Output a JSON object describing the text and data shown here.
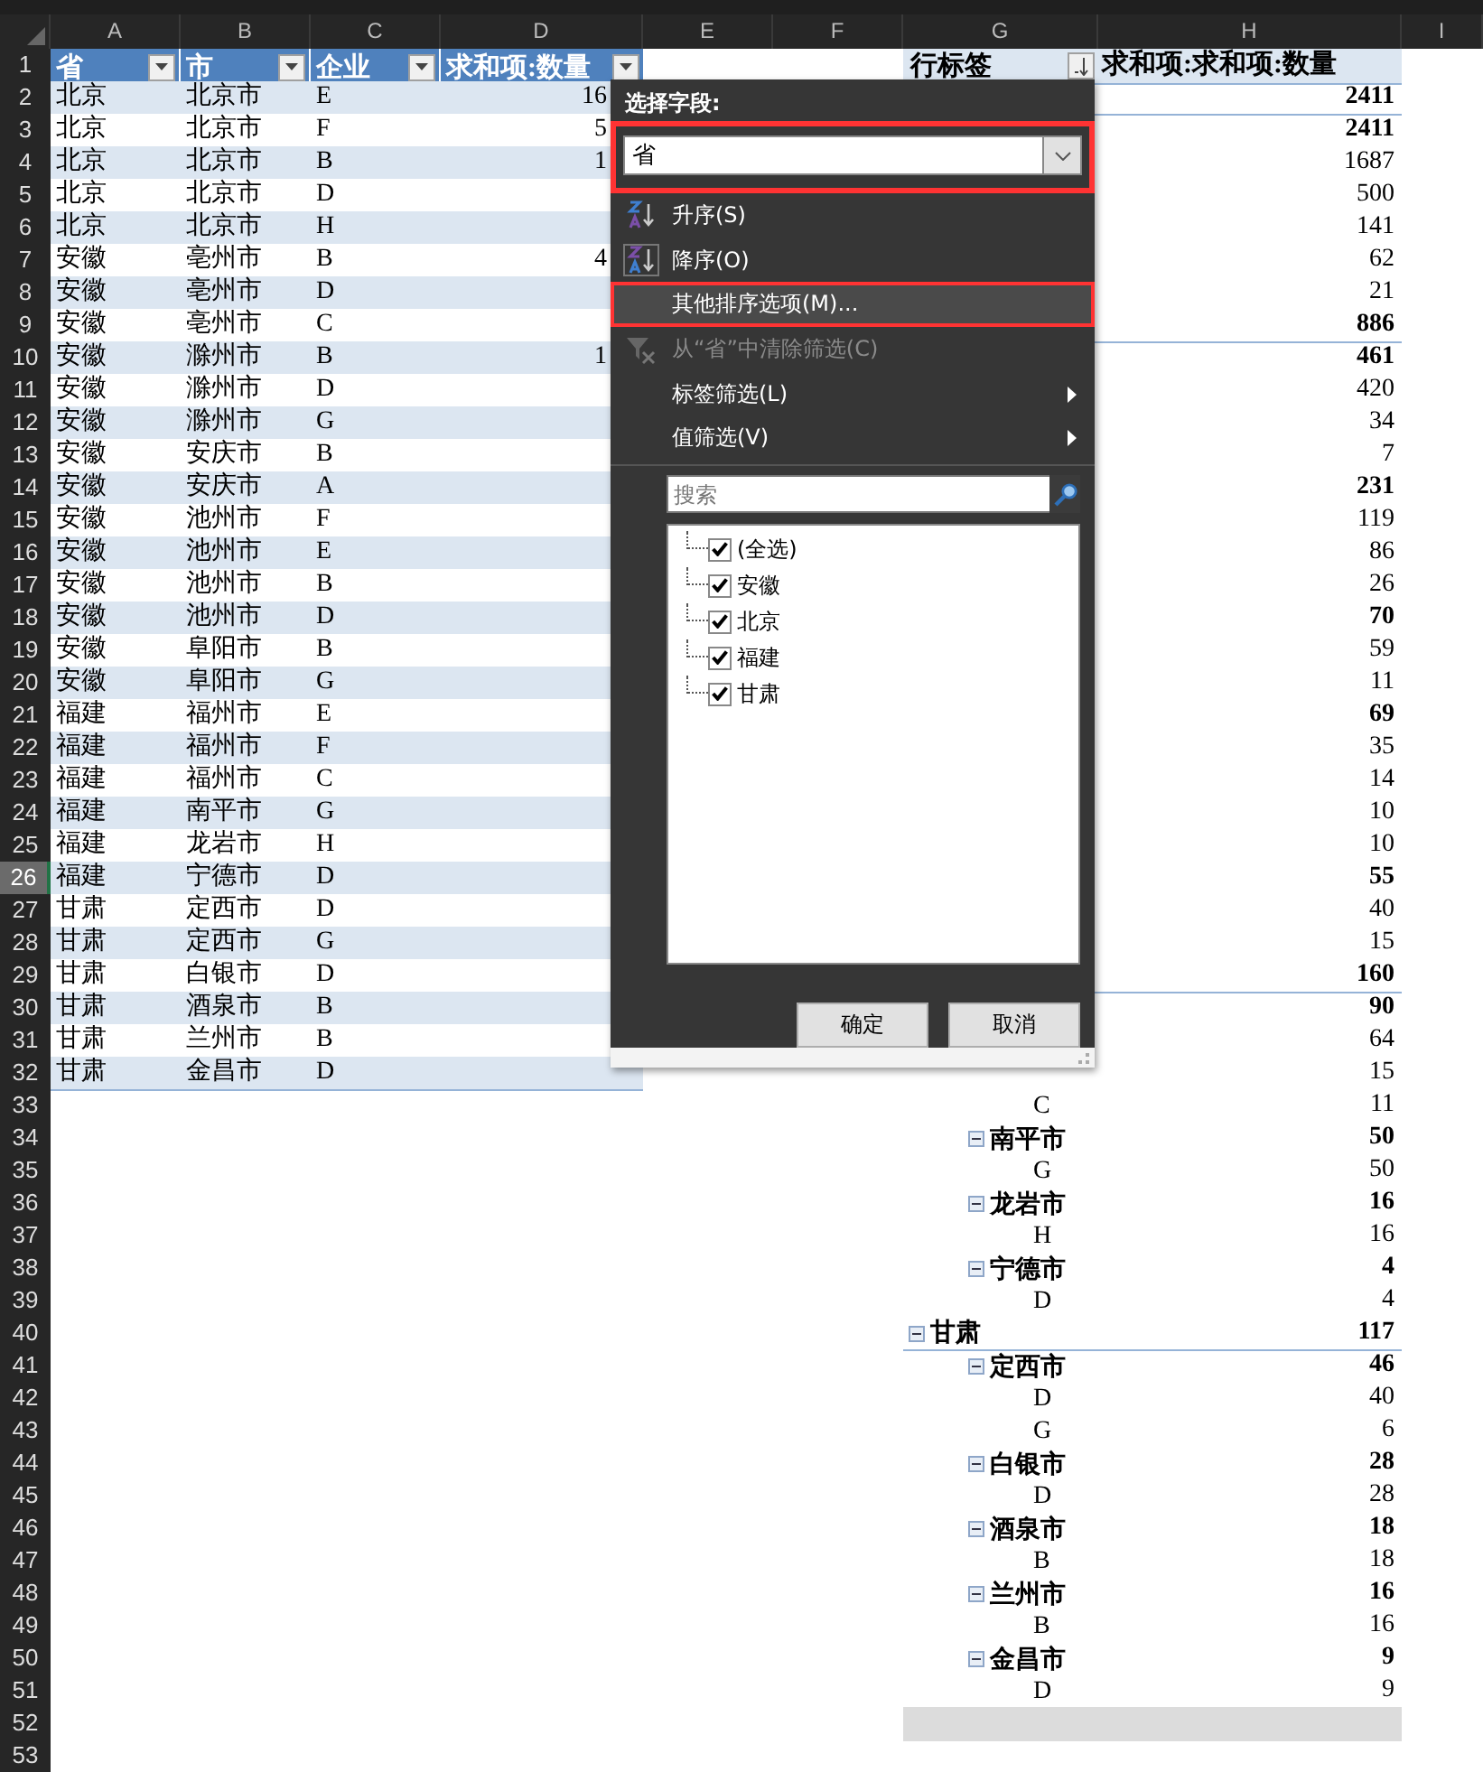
{
  "columns": [
    "A",
    "B",
    "C",
    "D",
    "E",
    "F",
    "G",
    "H",
    "I"
  ],
  "row_numbers": [
    {
      "label": "1",
      "selected": false
    },
    {
      "label": "2",
      "selected": false
    },
    {
      "label": "3",
      "selected": false
    },
    {
      "label": "4",
      "selected": false
    },
    {
      "label": "5",
      "selected": false
    },
    {
      "label": "6",
      "selected": false
    },
    {
      "label": "7",
      "selected": false
    },
    {
      "label": "8",
      "selected": false
    },
    {
      "label": "9",
      "selected": false
    },
    {
      "label": "10",
      "selected": false
    },
    {
      "label": "11",
      "selected": false
    },
    {
      "label": "12",
      "selected": false
    },
    {
      "label": "13",
      "selected": false
    },
    {
      "label": "14",
      "selected": false
    },
    {
      "label": "15",
      "selected": false
    },
    {
      "label": "16",
      "selected": false
    },
    {
      "label": "17",
      "selected": false
    },
    {
      "label": "18",
      "selected": false
    },
    {
      "label": "19",
      "selected": false
    },
    {
      "label": "20",
      "selected": false
    },
    {
      "label": "21",
      "selected": false
    },
    {
      "label": "22",
      "selected": false
    },
    {
      "label": "23",
      "selected": false
    },
    {
      "label": "24",
      "selected": false
    },
    {
      "label": "25",
      "selected": false
    },
    {
      "label": "26",
      "selected": true
    },
    {
      "label": "27",
      "selected": false
    },
    {
      "label": "28",
      "selected": false
    },
    {
      "label": "29",
      "selected": false
    },
    {
      "label": "30",
      "selected": false
    },
    {
      "label": "31",
      "selected": false
    },
    {
      "label": "32",
      "selected": false
    },
    {
      "label": "33",
      "selected": false
    },
    {
      "label": "34",
      "selected": false
    },
    {
      "label": "35",
      "selected": false
    },
    {
      "label": "36",
      "selected": false
    },
    {
      "label": "37",
      "selected": false
    },
    {
      "label": "38",
      "selected": false
    },
    {
      "label": "39",
      "selected": false
    },
    {
      "label": "40",
      "selected": false
    },
    {
      "label": "41",
      "selected": false
    },
    {
      "label": "42",
      "selected": false
    },
    {
      "label": "43",
      "selected": false
    },
    {
      "label": "44",
      "selected": false
    },
    {
      "label": "45",
      "selected": false
    },
    {
      "label": "46",
      "selected": false
    },
    {
      "label": "47",
      "selected": false
    },
    {
      "label": "48",
      "selected": false
    },
    {
      "label": "49",
      "selected": false
    },
    {
      "label": "50",
      "selected": false
    },
    {
      "label": "51",
      "selected": false
    },
    {
      "label": "52",
      "selected": false
    },
    {
      "label": "53",
      "selected": false
    }
  ],
  "table": {
    "headers": [
      "省",
      "市",
      "企业",
      "求和项:数量"
    ],
    "rows": [
      [
        "北京",
        "北京市",
        "E",
        "16"
      ],
      [
        "北京",
        "北京市",
        "F",
        "5"
      ],
      [
        "北京",
        "北京市",
        "B",
        "1"
      ],
      [
        "北京",
        "北京市",
        "D"
      ],
      [
        "北京",
        "北京市",
        "H"
      ],
      [
        "安徽",
        "亳州市",
        "B",
        "4"
      ],
      [
        "安徽",
        "亳州市",
        "D"
      ],
      [
        "安徽",
        "亳州市",
        "C"
      ],
      [
        "安徽",
        "滁州市",
        "B",
        "1"
      ],
      [
        "安徽",
        "滁州市",
        "D"
      ],
      [
        "安徽",
        "滁州市",
        "G"
      ],
      [
        "安徽",
        "安庆市",
        "B"
      ],
      [
        "安徽",
        "安庆市",
        "A"
      ],
      [
        "安徽",
        "池州市",
        "F"
      ],
      [
        "安徽",
        "池州市",
        "E"
      ],
      [
        "安徽",
        "池州市",
        "B"
      ],
      [
        "安徽",
        "池州市",
        "D"
      ],
      [
        "安徽",
        "阜阳市",
        "B"
      ],
      [
        "安徽",
        "阜阳市",
        "G"
      ],
      [
        "福建",
        "福州市",
        "E"
      ],
      [
        "福建",
        "福州市",
        "F"
      ],
      [
        "福建",
        "福州市",
        "C"
      ],
      [
        "福建",
        "南平市",
        "G"
      ],
      [
        "福建",
        "龙岩市",
        "H"
      ],
      [
        "福建",
        "宁德市",
        "D"
      ],
      [
        "甘肃",
        "定西市",
        "D"
      ],
      [
        "甘肃",
        "定西市",
        "G"
      ],
      [
        "甘肃",
        "白银市",
        "D"
      ],
      [
        "甘肃",
        "酒泉市",
        "B"
      ],
      [
        "甘肃",
        "兰州市",
        "B"
      ],
      [
        "甘肃",
        "金昌市",
        "D"
      ]
    ]
  },
  "pivot": {
    "headers": [
      "行标签",
      "求和项:求和项:数量"
    ],
    "groups": [
      {
        "value": "2411",
        "children": [
          {
            "value": "2411",
            "children": [
              {
                "value": "1687"
              },
              {
                "value": "500"
              },
              {
                "value": "141"
              },
              {
                "value": "62"
              },
              {
                "value": "21"
              }
            ]
          }
        ]
      },
      {
        "value": "886",
        "children": [
          {
            "value": "461",
            "children": [
              {
                "value": "420"
              },
              {
                "value": "34"
              },
              {
                "value": "7"
              }
            ]
          },
          {
            "value": "231",
            "children": [
              {
                "value": "119"
              },
              {
                "value": "86"
              },
              {
                "value": "26"
              }
            ]
          },
          {
            "value": "70",
            "children": [
              {
                "value": "59"
              },
              {
                "value": "11"
              }
            ]
          },
          {
            "value": "69",
            "children": [
              {
                "value": "35"
              },
              {
                "value": "14"
              },
              {
                "value": "10"
              },
              {
                "value": "10"
              }
            ]
          },
          {
            "value": "55",
            "children": [
              {
                "value": "40"
              },
              {
                "value": "15"
              }
            ]
          }
        ]
      },
      {
        "value": "160",
        "children": [
          {
            "value": "90",
            "children": [
              {
                "value": "64"
              },
              {
                "value": "15"
              },
              {
                "label": "C",
                "value": "11"
              }
            ]
          },
          {
            "label": "南平市",
            "expanded": true,
            "value": "50",
            "children": [
              {
                "label": "G",
                "value": "50"
              }
            ]
          },
          {
            "label": "龙岩市",
            "expanded": true,
            "value": "16",
            "children": [
              {
                "label": "H",
                "value": "16"
              }
            ]
          },
          {
            "label": "宁德市",
            "expanded": true,
            "value": "4",
            "children": [
              {
                "label": "D",
                "value": "4"
              }
            ]
          }
        ]
      },
      {
        "label": "甘肃",
        "expanded": true,
        "value": "117",
        "children": [
          {
            "label": "定西市",
            "expanded": true,
            "value": "46",
            "children": [
              {
                "label": "D",
                "value": "40"
              },
              {
                "label": "G",
                "value": "6"
              }
            ]
          },
          {
            "label": "白银市",
            "expanded": true,
            "value": "28",
            "children": [
              {
                "label": "D",
                "value": "28"
              }
            ]
          },
          {
            "label": "酒泉市",
            "expanded": true,
            "value": "18",
            "children": [
              {
                "label": "B",
                "value": "18"
              }
            ]
          },
          {
            "label": "兰州市",
            "expanded": true,
            "value": "16",
            "children": [
              {
                "label": "B",
                "value": "16"
              }
            ]
          },
          {
            "label": "金昌市",
            "expanded": true,
            "value": "9",
            "children": [
              {
                "label": "D",
                "value": "9"
              }
            ]
          }
        ]
      }
    ]
  },
  "filter_popup": {
    "field_label": "选择字段:",
    "field": {
      "value": "省",
      "highlighted": true
    },
    "menu_items": [
      {
        "kind": "sort_ascending",
        "label": "升序(S)",
        "disabled": false,
        "highlighted": false
      },
      {
        "kind": "sort_descending",
        "label": "降序(O)",
        "disabled": false,
        "highlighted": false
      },
      {
        "kind": "command",
        "label": "其他排序选项(M)...",
        "disabled": false,
        "highlighted": true
      },
      {
        "kind": "clear_filter",
        "label": "从“省”中清除筛选(C)",
        "disabled": true,
        "highlighted": false
      },
      {
        "kind": "submenu",
        "label": "标签筛选(L)",
        "disabled": false,
        "highlighted": false
      },
      {
        "kind": "submenu",
        "label": "值筛选(V)",
        "disabled": false,
        "highlighted": false
      }
    ],
    "search": {
      "placeholder": "搜索"
    },
    "values": [
      {
        "label": "(全选)",
        "checked": true
      },
      {
        "label": "安徽",
        "checked": true
      },
      {
        "label": "北京",
        "checked": true
      },
      {
        "label": "福建",
        "checked": true
      },
      {
        "label": "甘肃",
        "checked": true
      }
    ],
    "buttons": [
      "确定",
      "取消"
    ]
  }
}
